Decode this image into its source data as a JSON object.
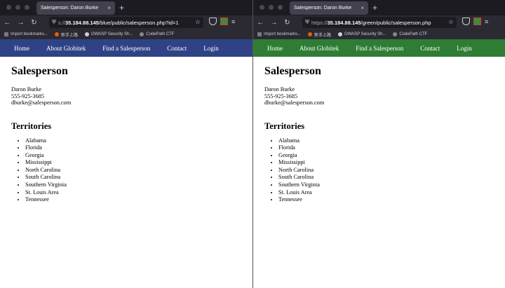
{
  "left": {
    "tab_title": "Salesperson: Daron Burke",
    "url_prefix_muted": "s://",
    "url_host": "35.184.88.145",
    "url_path": "/blue/public/salesperson.php?id=1",
    "nav_color": "#2e4386"
  },
  "right": {
    "tab_title": "Salesperson: Daron Burke",
    "url_prefix_muted": "https://",
    "url_host": "35.184.88.145",
    "url_path": "/green/public/salesperson.php",
    "nav_color": "#2f7d35"
  },
  "bookmarks": {
    "import": "Import bookmarks...",
    "item1": "新手上路",
    "item2": "OWASP Security Sh...",
    "item3": "CodePath CTF"
  },
  "nav": [
    "Home",
    "About Globitek",
    "Find a Salesperson",
    "Contact",
    "Login"
  ],
  "page": {
    "heading": "Salesperson",
    "name": "Daron Burke",
    "phone": "555-925-3685",
    "email": "dburke@salesperson.com",
    "territories_heading": "Territories",
    "territories": [
      "Alabama",
      "Florida",
      "Georgia",
      "Mississippi",
      "North Carolina",
      "South Carolina",
      "Southern Virginia",
      "St. Louis Area",
      "Tennessee"
    ]
  },
  "icons": {
    "close": "×",
    "newtab": "+",
    "back": "←",
    "forward": "→",
    "reload": "↻",
    "lock": "⛨",
    "star": "☆",
    "menu": "≡"
  }
}
